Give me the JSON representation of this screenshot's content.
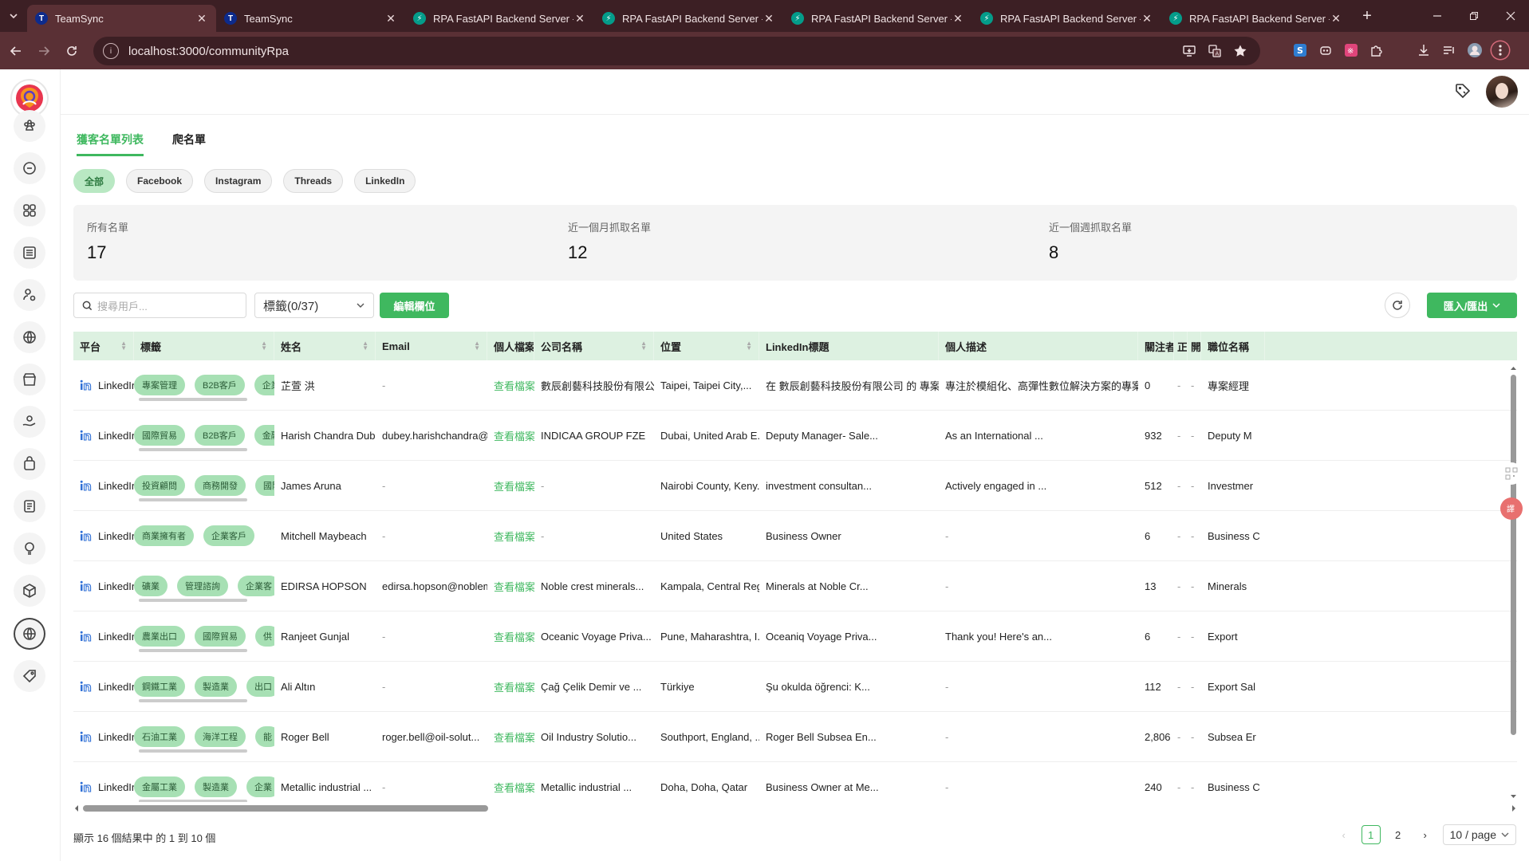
{
  "browser": {
    "tabs": [
      {
        "title": "TeamSync",
        "favicon": "teamsync-icon",
        "active": true
      },
      {
        "title": "TeamSync",
        "favicon": "teamsync-icon",
        "active": false
      },
      {
        "title": "RPA FastAPI Backend Server -",
        "favicon": "fastapi-icon",
        "active": false
      },
      {
        "title": "RPA FastAPI Backend Server -",
        "favicon": "fastapi-icon",
        "active": false
      },
      {
        "title": "RPA FastAPI Backend Server -",
        "favicon": "fastapi-icon",
        "active": false
      },
      {
        "title": "RPA FastAPI Backend Server -",
        "favicon": "fastapi-icon",
        "active": false
      },
      {
        "title": "RPA FastAPI Backend Server -",
        "favicon": "fastapi-icon",
        "active": false
      }
    ],
    "url": "localhost:3000/communityRpa"
  },
  "main_tabs": {
    "customer_list": "獲客名單列表",
    "crawl_list": "爬名單"
  },
  "filters": {
    "all": "全部",
    "facebook": "Facebook",
    "instagram": "Instagram",
    "threads": "Threads",
    "linkedin": "LinkedIn"
  },
  "stats": {
    "total_label": "所有名單",
    "total_value": "17",
    "month_label": "近一個月抓取名單",
    "month_value": "12",
    "week_label": "近一個週抓取名單",
    "week_value": "8"
  },
  "toolbar": {
    "search_placeholder": "搜尋用戶...",
    "tag_select": "標籤(0/37)",
    "edit_columns": "編輯欄位",
    "import_export": "匯入/匯出"
  },
  "table": {
    "columns": [
      "平台",
      "標籤",
      "姓名",
      "Email",
      "個人檔案",
      "公司名稱",
      "位置",
      "LinkedIn標題",
      "個人描述",
      "關注者",
      "正",
      "開",
      "職位名稱"
    ],
    "rows": [
      {
        "platform": "LinkedIn",
        "tags": [
          "專案管理",
          "B2B客戶",
          "企業"
        ],
        "name": "芷萱 洪",
        "email": "-",
        "profile": "查看檔案",
        "company": "數辰創藝科技股份有限公司",
        "location": "Taipei, Taipei City,...",
        "headline": "在 數辰創藝科技股份有限公司 的 專案經...",
        "description": "專注於模組化、高彈性數位解決方案的專案管...",
        "followers": "0",
        "c1": "-",
        "c2": "-",
        "title": "專案經理"
      },
      {
        "platform": "LinkedIn",
        "tags": [
          "國際貿易",
          "B2B客戶",
          "金融"
        ],
        "name": "Harish Chandra Dubey",
        "email": "dubey.harishchandra@...",
        "profile": "查看檔案",
        "company": "INDICAA GROUP FZE",
        "location": "Dubai, United Arab E...",
        "headline": "Deputy Manager- Sale...",
        "description": "As an International ...",
        "followers": "932",
        "c1": "-",
        "c2": "-",
        "title": "Deputy M"
      },
      {
        "platform": "LinkedIn",
        "tags": [
          "投資顧問",
          "商務開發",
          "國際"
        ],
        "name": "James Aruna",
        "email": "-",
        "profile": "查看檔案",
        "company": "-",
        "location": "Nairobi County, Keny...",
        "headline": "investment consultan...",
        "description": "Actively engaged in ...",
        "followers": "512",
        "c1": "-",
        "c2": "-",
        "title": "Investmer"
      },
      {
        "platform": "LinkedIn",
        "tags": [
          "商業擁有者",
          "企業客戶"
        ],
        "name": "Mitchell Maybeach",
        "email": "-",
        "profile": "查看檔案",
        "company": "-",
        "location": "United States",
        "headline": "Business Owner",
        "description": "-",
        "followers": "6",
        "c1": "-",
        "c2": "-",
        "title": "Business C"
      },
      {
        "platform": "LinkedIn",
        "tags": [
          "礦業",
          "管理諮詢",
          "企業客"
        ],
        "name": "EDIRSA HOPSON",
        "email": "edirsa.hopson@noblem...",
        "profile": "查看檔案",
        "company": "Noble crest minerals...",
        "location": "Kampala, Central Reg...",
        "headline": "Minerals at Noble Cr...",
        "description": "-",
        "followers": "13",
        "c1": "-",
        "c2": "-",
        "title": "Minerals"
      },
      {
        "platform": "LinkedIn",
        "tags": [
          "農業出口",
          "國際貿易",
          "供"
        ],
        "name": "Ranjeet Gunjal",
        "email": "-",
        "profile": "查看檔案",
        "company": "Oceanic Voyage Priva...",
        "location": "Pune, Maharashtra, I...",
        "headline": "Oceaniq Voyage Priva...",
        "description": "Thank you! Here's an...",
        "followers": "6",
        "c1": "-",
        "c2": "-",
        "title": "Export"
      },
      {
        "platform": "LinkedIn",
        "tags": [
          "鋼鐵工業",
          "製造業",
          "出口"
        ],
        "name": "Ali Altın",
        "email": "-",
        "profile": "查看檔案",
        "company": "Çağ Çelik Demir ve ...",
        "location": "Türkiye",
        "headline": "Şu okulda öğrenci: K...",
        "description": "-",
        "followers": "112",
        "c1": "-",
        "c2": "-",
        "title": "Export Sal"
      },
      {
        "platform": "LinkedIn",
        "tags": [
          "石油工業",
          "海洋工程",
          "能"
        ],
        "name": "Roger Bell",
        "email": "roger.bell@oil-solut...",
        "profile": "查看檔案",
        "company": "Oil Industry Solutio...",
        "location": "Southport, England, ...",
        "headline": "Roger Bell Subsea En...",
        "description": "-",
        "followers": "2,806",
        "c1": "-",
        "c2": "-",
        "title": "Subsea Er"
      },
      {
        "platform": "LinkedIn",
        "tags": [
          "金屬工業",
          "製造業",
          "企業"
        ],
        "name": "Metallic industrial ...",
        "email": "-",
        "profile": "查看檔案",
        "company": "Metallic industrial ...",
        "location": "Doha, Doha, Qatar",
        "headline": "Business Owner at Me...",
        "description": "-",
        "followers": "240",
        "c1": "-",
        "c2": "-",
        "title": "Business C"
      }
    ]
  },
  "footer": {
    "summary": "顯示 16 個結果中 的 1 到 10 個",
    "pages": [
      "1",
      "2"
    ],
    "page_size": "10 / page"
  },
  "colors": {
    "accent": "#3fb85f",
    "tag_bg": "#a7e0b4",
    "header_bg": "#ddf1e1",
    "browser_frame": "#5a3035"
  }
}
